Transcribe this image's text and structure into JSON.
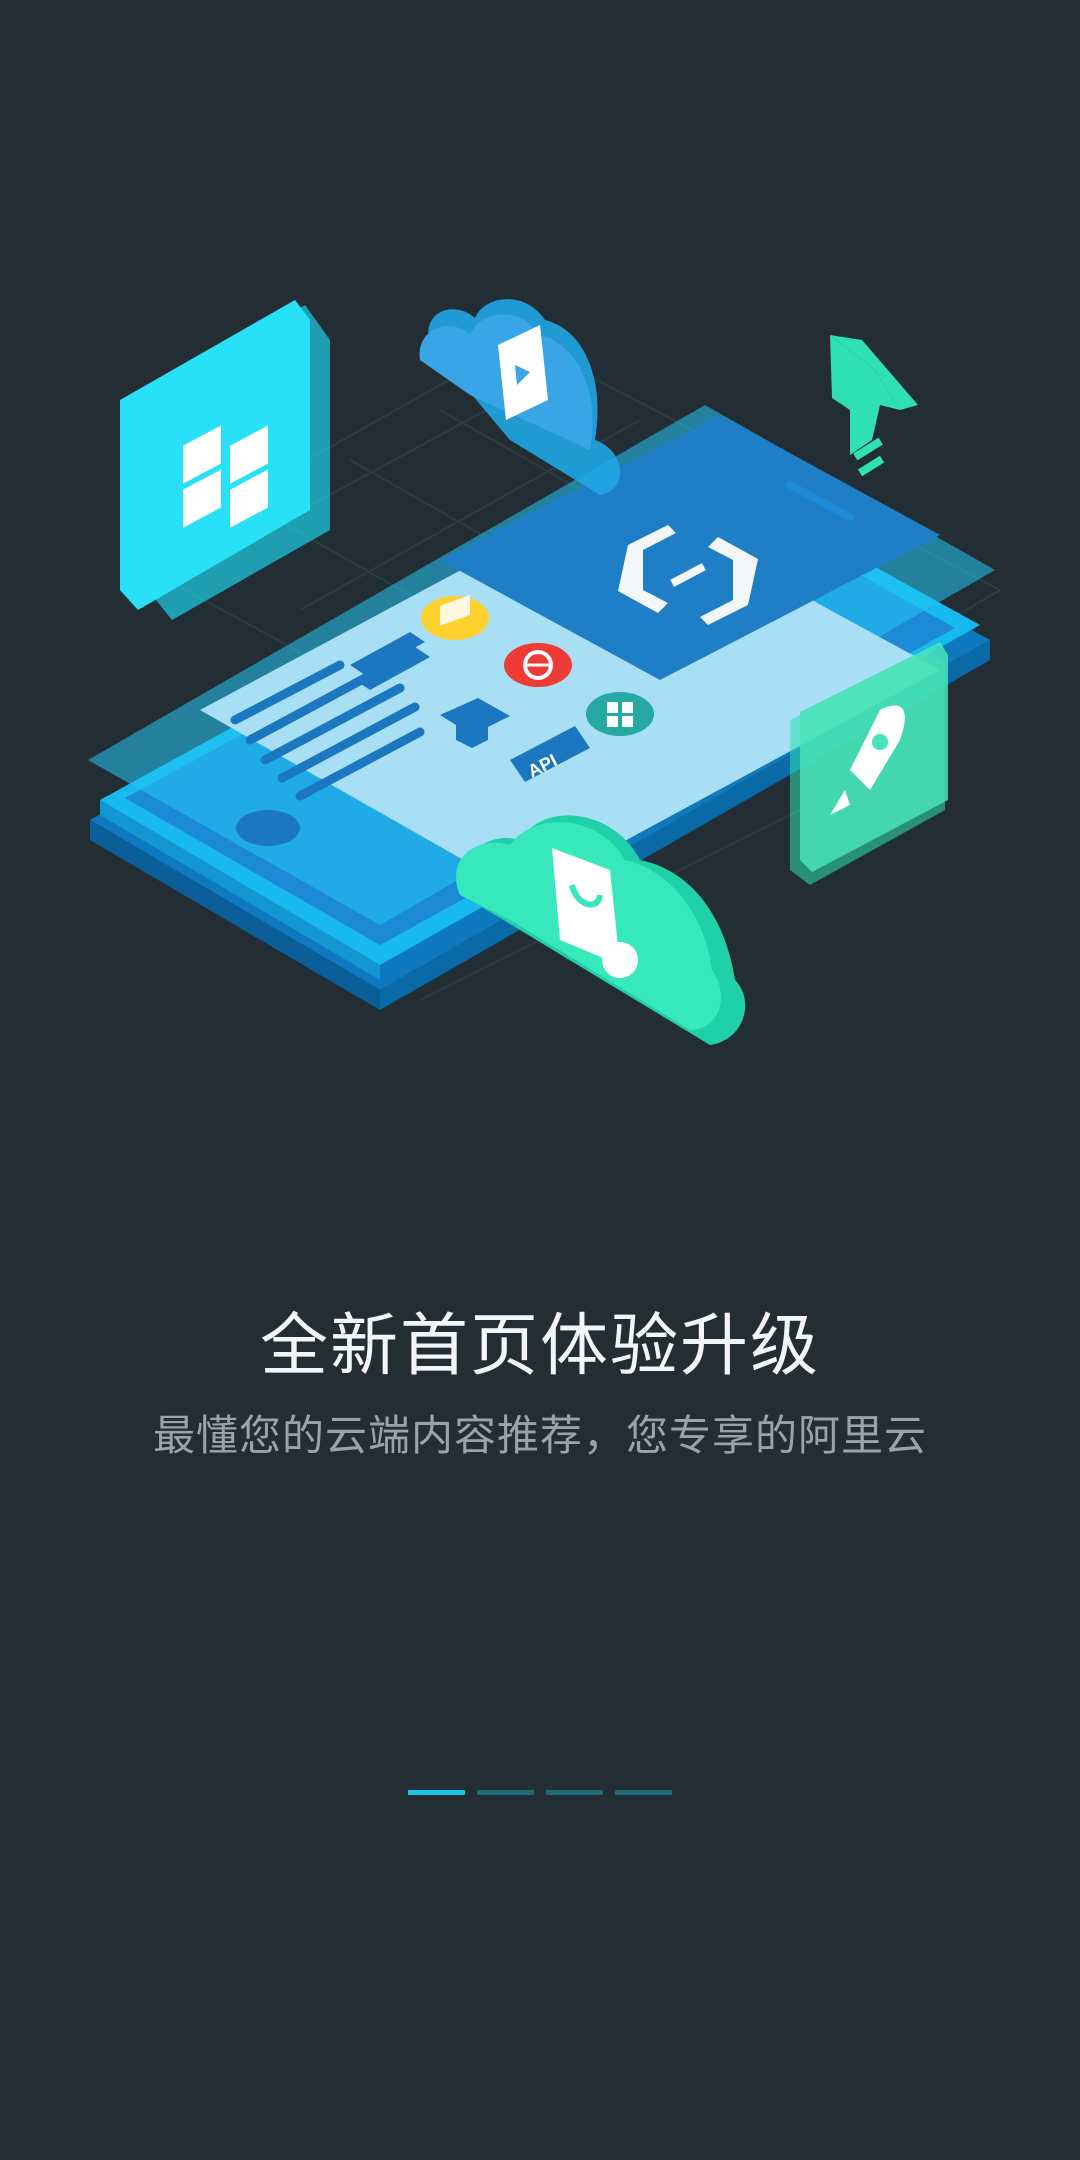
{
  "onboarding": {
    "headline": "全新首页体验升级",
    "subtitle": "最懂您的云端内容推荐，您专享的阿里云",
    "illustration": {
      "api_label": "API",
      "icons": [
        "apps-icon",
        "book-cloud-icon",
        "upgrade-arrow-icon",
        "aliyun-logo-icon",
        "rocket-icon",
        "shopping-bag-cloud-icon",
        "globe-icon",
        "graduation-cap-icon",
        "server-icon",
        "folder-icon"
      ]
    },
    "pager": {
      "total": 4,
      "active_index": 0
    }
  },
  "colors": {
    "background": "#222d34",
    "accent": "#1ec7ea",
    "green": "#2fe0b4",
    "inactive_dot": "#1f6a76"
  }
}
